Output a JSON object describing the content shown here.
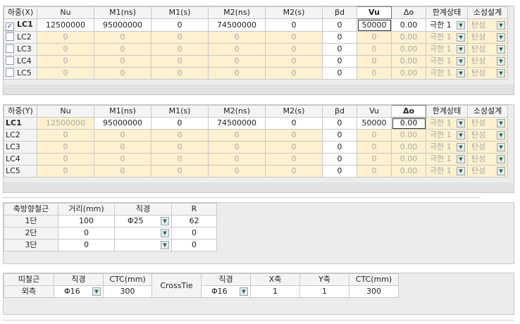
{
  "load_x": {
    "headers": [
      "하중(X)",
      "Nu",
      "M1(ns)",
      "M1(s)",
      "M2(ns)",
      "M2(s)",
      "βd",
      "Vu",
      "Δo",
      "한계상태",
      "소성설계"
    ],
    "rows": [
      {
        "lc": "LC1",
        "checked": true,
        "nu": "12500000",
        "m1ns": "95000000",
        "m1s": "0",
        "m2ns": "74500000",
        "m2s": "0",
        "bd": "0",
        "vu": "50000",
        "do": "0.00",
        "limit": "극한 1",
        "plastic": "탄성"
      },
      {
        "lc": "LC2",
        "checked": false,
        "nu": "0",
        "m1ns": "0",
        "m1s": "0",
        "m2ns": "0",
        "m2s": "0",
        "bd": "0",
        "vu": "0",
        "do": "0.00",
        "limit": "극한 1",
        "plastic": "탄성"
      },
      {
        "lc": "LC3",
        "checked": false,
        "nu": "0",
        "m1ns": "0",
        "m1s": "0",
        "m2ns": "0",
        "m2s": "0",
        "bd": "0",
        "vu": "0",
        "do": "0.00",
        "limit": "극한 1",
        "plastic": "탄성"
      },
      {
        "lc": "LC4",
        "checked": false,
        "nu": "0",
        "m1ns": "0",
        "m1s": "0",
        "m2ns": "0",
        "m2s": "0",
        "bd": "0",
        "vu": "0",
        "do": "0.00",
        "limit": "극한 1",
        "plastic": "탄성"
      },
      {
        "lc": "LC5",
        "checked": false,
        "nu": "0",
        "m1ns": "0",
        "m1s": "0",
        "m2ns": "0",
        "m2s": "0",
        "bd": "0",
        "vu": "0",
        "do": "0.00",
        "limit": "극한 1",
        "plastic": "탄성"
      }
    ]
  },
  "load_y": {
    "headers": [
      "하중(Y)",
      "Nu",
      "M1(ns)",
      "M1(s)",
      "M2(ns)",
      "M2(s)",
      "βd",
      "Vu",
      "Δo",
      "한계상태",
      "소성설계"
    ],
    "rows": [
      {
        "lc": "LC1",
        "nu": "12500000",
        "m1ns": "95000000",
        "m1s": "0",
        "m2ns": "74500000",
        "m2s": "0",
        "bd": "0",
        "vu": "50000",
        "do": "0.00",
        "limit": "극한 1",
        "plastic": "탄성"
      },
      {
        "lc": "LC2",
        "nu": "0",
        "m1ns": "0",
        "m1s": "0",
        "m2ns": "0",
        "m2s": "0",
        "bd": "0",
        "vu": "0",
        "do": "0.00",
        "limit": "극한 1",
        "plastic": "탄성"
      },
      {
        "lc": "LC3",
        "nu": "0",
        "m1ns": "0",
        "m1s": "0",
        "m2ns": "0",
        "m2s": "0",
        "bd": "0",
        "vu": "0",
        "do": "0.00",
        "limit": "극한 1",
        "plastic": "탄성"
      },
      {
        "lc": "LC4",
        "nu": "0",
        "m1ns": "0",
        "m1s": "0",
        "m2ns": "0",
        "m2s": "0",
        "bd": "0",
        "vu": "0",
        "do": "0.00",
        "limit": "극한 1",
        "plastic": "탄성"
      },
      {
        "lc": "LC5",
        "nu": "0",
        "m1ns": "0",
        "m1s": "0",
        "m2ns": "0",
        "m2s": "0",
        "bd": "0",
        "vu": "0",
        "do": "0.00",
        "limit": "극한 1",
        "plastic": "탄성"
      }
    ]
  },
  "axial_rebar": {
    "headers": [
      "축방향철근",
      "거리(mm)",
      "직경",
      "R"
    ],
    "rows": [
      {
        "label": "1단",
        "distance": "100",
        "diameter": "Φ25",
        "r": "62"
      },
      {
        "label": "2단",
        "distance": "0",
        "diameter": "",
        "r": "0"
      },
      {
        "label": "3단",
        "distance": "0",
        "diameter": "",
        "r": "0"
      }
    ]
  },
  "tie_rebar": {
    "headers": [
      "띠철근",
      "직경",
      "CTC(mm)",
      "CrossTie",
      "직경",
      "X축",
      "Y축",
      "CTC(mm)"
    ],
    "row": {
      "label": "외측",
      "diameter": "Φ16",
      "ctc": "300",
      "cross_diameter": "Φ16",
      "x": "1",
      "y": "1",
      "cross_ctc": "300"
    }
  }
}
